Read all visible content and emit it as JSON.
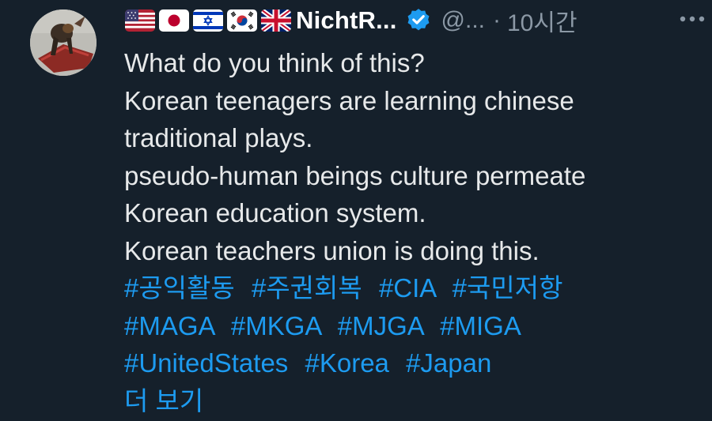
{
  "tweet": {
    "display_name": "NichtR...",
    "handle": "@...",
    "separator": "·",
    "timestamp": "10시간",
    "flags": [
      {
        "icon": "flag-us-icon",
        "country": "United States"
      },
      {
        "icon": "flag-jp-icon",
        "country": "Japan"
      },
      {
        "icon": "flag-il-icon",
        "country": "Israel"
      },
      {
        "icon": "flag-kr-icon",
        "country": "South Korea"
      },
      {
        "icon": "flag-gb-icon",
        "country": "United Kingdom"
      }
    ],
    "verified_icon": "verified-badge-icon",
    "more_icon": "more-options-icon",
    "text_lines": [
      "What do you think of this?",
      "Korean teenagers are learning chinese",
      "traditional plays.",
      "pseudo-human beings culture permeate",
      "Korean education system.",
      "Korean teachers union is doing this."
    ],
    "hashtag_lines": [
      [
        "#공익활동",
        "#주권회복",
        "#CIA",
        "#국민저항"
      ],
      [
        "#MAGA",
        "#MKGA",
        "#MJGA",
        "#MIGA"
      ],
      [
        "#UnitedStates",
        "#Korea",
        "#Japan"
      ]
    ],
    "show_more": "더 보기",
    "colors": {
      "background": "#15202b",
      "text": "#e7e9ea",
      "secondary_text": "#8b98a5",
      "link": "#1d9bf0",
      "verified": "#1d9bf0"
    }
  }
}
